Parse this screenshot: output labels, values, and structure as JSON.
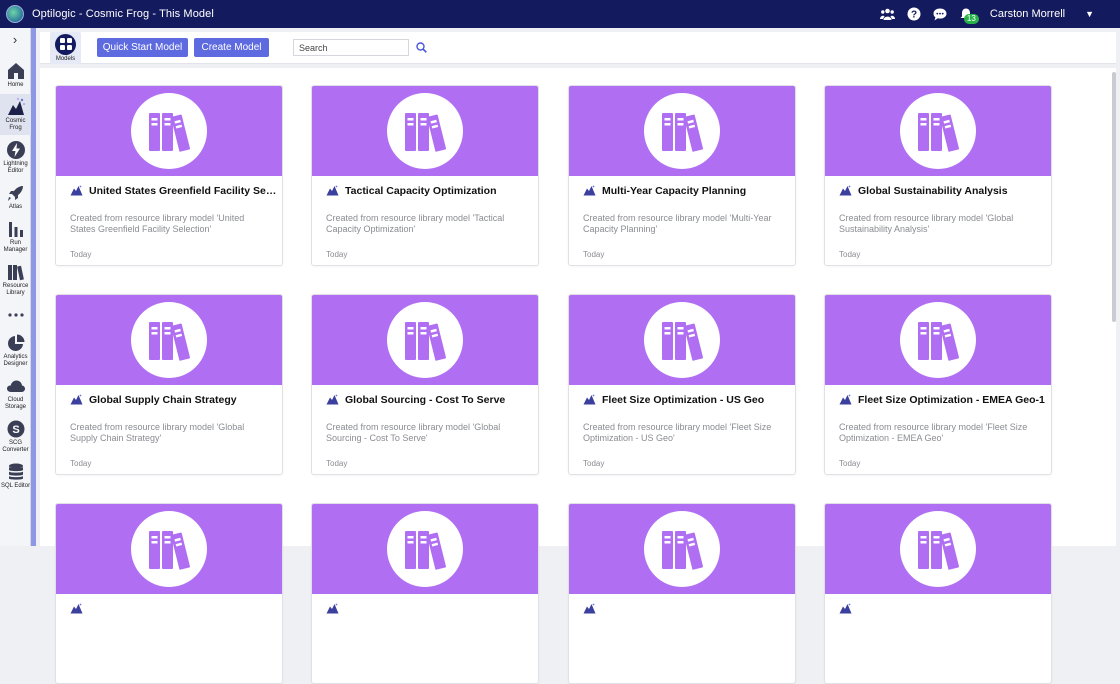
{
  "app": {
    "title": "Optilogic - Cosmic Frog - This Model",
    "user_name": "Carston Morrell",
    "notification_count": "13"
  },
  "sidebar": {
    "items": [
      {
        "label": "Home",
        "icon": "home-icon"
      },
      {
        "label": "Cosmic Frog",
        "icon": "cosmic-frog-icon",
        "active": true
      },
      {
        "label": "Lightning Editor",
        "icon": "lightning-icon"
      },
      {
        "label": "Atlas",
        "icon": "rocket-icon"
      },
      {
        "label": "Run Manager",
        "icon": "bar-chart-icon"
      },
      {
        "label": "Resource Library",
        "icon": "books-icon"
      },
      {
        "label": "",
        "icon": "more-dots-icon"
      },
      {
        "label": "Analytics Designer",
        "icon": "pie-chart-icon"
      },
      {
        "label": "Cloud Storage",
        "icon": "cloud-icon"
      },
      {
        "label": "SCG Converter",
        "icon": "converter-icon"
      },
      {
        "label": "SQL Editor",
        "icon": "database-icon"
      }
    ]
  },
  "toolbar": {
    "models_label": "Models",
    "quick_start_label": "Quick Start Model",
    "create_model_label": "Create Model",
    "search_placeholder": "Search"
  },
  "colors": {
    "topbar": "#131a5e",
    "banner": "#b06ef3",
    "button": "#5d6ae0"
  },
  "models": [
    {
      "name": "United States Greenfield Facility Selection",
      "description": "Created from resource library model 'United States Greenfield Facility Selection'",
      "date": "Today"
    },
    {
      "name": "Tactical Capacity Optimization",
      "description": "Created from resource library model 'Tactical Capacity Optimization'",
      "date": "Today"
    },
    {
      "name": "Multi-Year Capacity Planning",
      "description": "Created from resource library model 'Multi-Year Capacity Planning'",
      "date": "Today"
    },
    {
      "name": "Global Sustainability Analysis",
      "description": "Created from resource library model 'Global Sustainability Analysis'",
      "date": "Today"
    },
    {
      "name": "Global Supply Chain Strategy",
      "description": "Created from resource library model 'Global Supply Chain Strategy'",
      "date": "Today"
    },
    {
      "name": "Global Sourcing - Cost To Serve",
      "description": "Created from resource library model 'Global Sourcing - Cost To Serve'",
      "date": "Today"
    },
    {
      "name": "Fleet Size Optimization - US Geo",
      "description": "Created from resource library model 'Fleet Size Optimization - US Geo'",
      "date": "Today"
    },
    {
      "name": "Fleet Size Optimization - EMEA Geo-1",
      "description": "Created from resource library model 'Fleet Size Optimization - EMEA Geo'",
      "date": "Today"
    },
    {
      "name": "",
      "description": "",
      "date": ""
    },
    {
      "name": "",
      "description": "",
      "date": ""
    },
    {
      "name": "",
      "description": "",
      "date": ""
    },
    {
      "name": "",
      "description": "",
      "date": ""
    }
  ]
}
